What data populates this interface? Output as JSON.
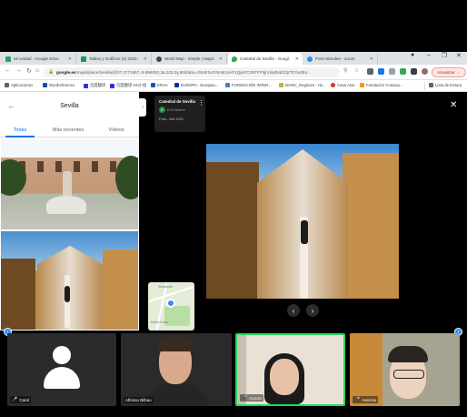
{
  "browser": {
    "tabs": [
      {
        "title": "Mi unidad - Google Drive",
        "color": "#1fa463",
        "active": false
      },
      {
        "title": "Tablas y Gráficos (4) 2019 - ",
        "color": "#0f9d58",
        "active": false
      },
      {
        "title": "World Map - Simple | MapC",
        "color": "#444444",
        "active": false
      },
      {
        "title": "Catedral de Sevilla - Googl",
        "color": "#34a853",
        "active": true
      },
      {
        "title": "Post Attendee - Zoom",
        "color": "#2d8cff",
        "active": false
      }
    ],
    "new_tab": "+",
    "url_host": "google.es",
    "url_path": "/maps/place/Sevilla/@37.3771957,-5.996093,3a,103.3y,90t/data=!3m8!1e2!3m6!1sAF1QipPC2NTFFdjrVxlyBsdZZjr7E7w4Bn...",
    "update_label": "Actualizar",
    "bookmarks": [
      {
        "label": "Aplicaciones",
        "color": "#5f6368"
      },
      {
        "label": "Wordreference",
        "color": "#1a4f9c"
      },
      {
        "label": "百度翻译",
        "color": "#2932e1"
      },
      {
        "label": "百度翻译 HN小组",
        "color": "#2932e1"
      },
      {
        "label": "ERAA",
        "color": "#0b5cad"
      },
      {
        "label": "EUROPA - Europea...",
        "color": "#003399"
      },
      {
        "label": "FORMACIÓN INTER...",
        "color": "#4a7fb5"
      },
      {
        "label": "MARC_Regimes - Ho...",
        "color": "#c9b037"
      },
      {
        "label": "Casa Asia",
        "color": "#d93025"
      },
      {
        "label": "Fundación Consejo...",
        "color": "#f29900"
      }
    ],
    "reading_list": "Lista de lectura"
  },
  "left_panel": {
    "title": "Sevilla",
    "tabs": [
      "Todas",
      "Más recientes",
      "Vídeos"
    ]
  },
  "viewer": {
    "place_name": "Catedral de Sevilla",
    "author_initial": "E",
    "author": "Enf Hélène",
    "date": "Foto - feb 2021",
    "minimap_labels": [
      "Sebastián",
      "María Luisa"
    ]
  },
  "zoom": {
    "participants": [
      {
        "name": "Carol",
        "muted": true,
        "video": false
      },
      {
        "name": "Alfonso Bilbao",
        "muted": false,
        "video": true
      },
      {
        "name": "Aurora",
        "muted": true,
        "video": true,
        "speaking": true
      },
      {
        "name": "Asensio",
        "muted": true,
        "video": true
      }
    ],
    "accent": "#23d959"
  }
}
